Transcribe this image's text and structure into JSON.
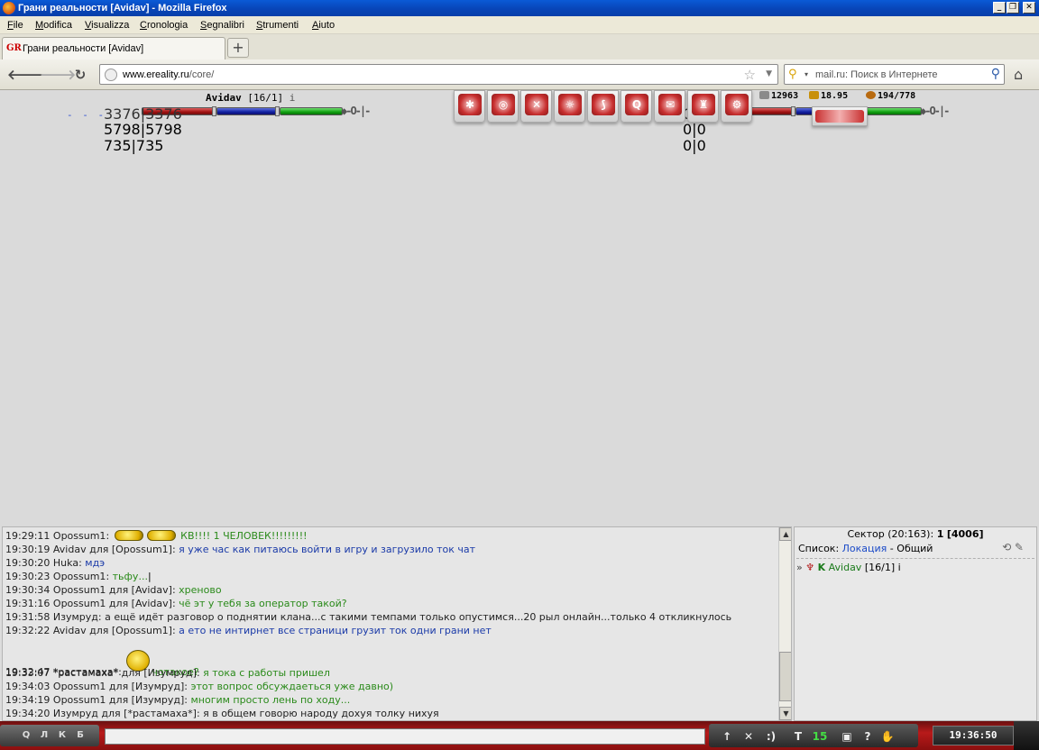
{
  "window": {
    "title": "Грани реальности [Avidav] - Mozilla Firefox",
    "controls": [
      "_",
      "❐",
      "✕"
    ]
  },
  "menu": [
    "File",
    "Modifica",
    "Visualizza",
    "Cronologia",
    "Segnalibri",
    "Strumenti",
    "Aiuto"
  ],
  "tab": {
    "favicon": "GR",
    "label": "Грани реальности [Avidav]",
    "new_tab": "+"
  },
  "nav": {
    "back": "🡐",
    "forward": "🡒",
    "reload": "↻",
    "url_host": "www.ereality.ru",
    "url_path": "/core/",
    "search_engine": "ℹ",
    "search_placeholder": "mail.ru: Поиск в Интернете",
    "home": "⌂"
  },
  "game": {
    "player": {
      "name": "Avidav",
      "level": "[16/1]",
      "info": "i"
    },
    "left_stats": [
      "3376|3376",
      "5798|5798",
      "735|735"
    ],
    "dashes": "- - -",
    "right_stats": [
      "0|0",
      "0|0",
      "0|0"
    ],
    "resources": [
      {
        "value": "12963",
        "icon_color": "#8a8a8a"
      },
      {
        "value": "18.95",
        "icon_color": "#c8900a"
      },
      {
        "value": "194/778",
        "icon_color": "#b86a10"
      }
    ],
    "actions": [
      "attack",
      "target",
      "cross",
      "group",
      "claw",
      "q",
      "mail",
      "arena",
      "gear"
    ]
  },
  "chat": [
    {
      "time": "19:29:11",
      "author": "Opossum1",
      "to": "",
      "smileys": "flash",
      "text": "КВ!!!! 1 ЧЕЛОВЕК!!!!!!!!!",
      "green": true
    },
    {
      "time": "19:30:19",
      "author": "Avidav",
      "to": "Opossum1",
      "text": "я уже час как питаюсь войти в игру и загрузило ток чат",
      "green": false
    },
    {
      "time": "19:30:20",
      "author": "Huka",
      "to": "",
      "text": "мдэ",
      "green": false
    },
    {
      "time": "19:30:23",
      "author": "Opossum1",
      "to": "",
      "text": "тьфу...",
      "green": true
    },
    {
      "time": "19:30:34",
      "author": "Opossum1",
      "to": "Avidav",
      "text": "хреново",
      "green": true
    },
    {
      "time": "19:31:16",
      "author": "Opossum1",
      "to": "Avidav",
      "text": "чё эт у тебя за оператор такой?",
      "green": true
    },
    {
      "time": "19:31:58",
      "author": "Изумруд",
      "to": "",
      "text": "а ещё идёт разговор о поднятии клана...с такими темпами только опустимся...20 рыл онлайн...только 4 откликнулось",
      "green": false,
      "plain": true
    },
    {
      "time": "19:32:22",
      "author": "Avidav",
      "to": "Opossum1",
      "text": "а ето не интирнет все страници грузит ток одни грани нет",
      "green": false
    },
    {
      "time": "19:32:47",
      "author": "*растамаха*",
      "to": "",
      "smileys": "big",
      "text": "чотакое?",
      "green": true
    },
    {
      "time": "19:33:07",
      "author": "*растамаха*",
      "to": "Изумруд",
      "text": "я тока с работы пришел",
      "green": true
    },
    {
      "time": "19:34:03",
      "author": "Opossum1",
      "to": "Изумруд",
      "text": "этот вопрос обсуждаеться уже давно)",
      "green": true
    },
    {
      "time": "19:34:19",
      "author": "Opossum1",
      "to": "Изумруд",
      "text": "многим просто лень по ходу...",
      "green": true
    },
    {
      "time": "19:34:20",
      "author": "Изумруд",
      "to": "*растамаха*",
      "text": "я в общем говорю народу дохуя толку нихуя",
      "green": false,
      "plain": true
    }
  ],
  "sector": {
    "label": "Сектор (20:163):",
    "count": "1",
    "total": "[4006]",
    "list_label": "Список:",
    "list_link": "Локация",
    "list_sep": "-",
    "list_other": "Общий",
    "tools": "⟲ ✎",
    "members": [
      {
        "bullet": "»",
        "clan": "♆",
        "rank": "K",
        "name": "Avidav",
        "level": "[16/1]",
        "info": "i"
      }
    ]
  },
  "bottom": {
    "channels": [
      "Q",
      "Л",
      "К",
      "Б"
    ],
    "tools": [
      "↑",
      "✕",
      ":)",
      "T",
      "15",
      "▣",
      "?",
      "✋"
    ],
    "clock": "19:36:50"
  }
}
